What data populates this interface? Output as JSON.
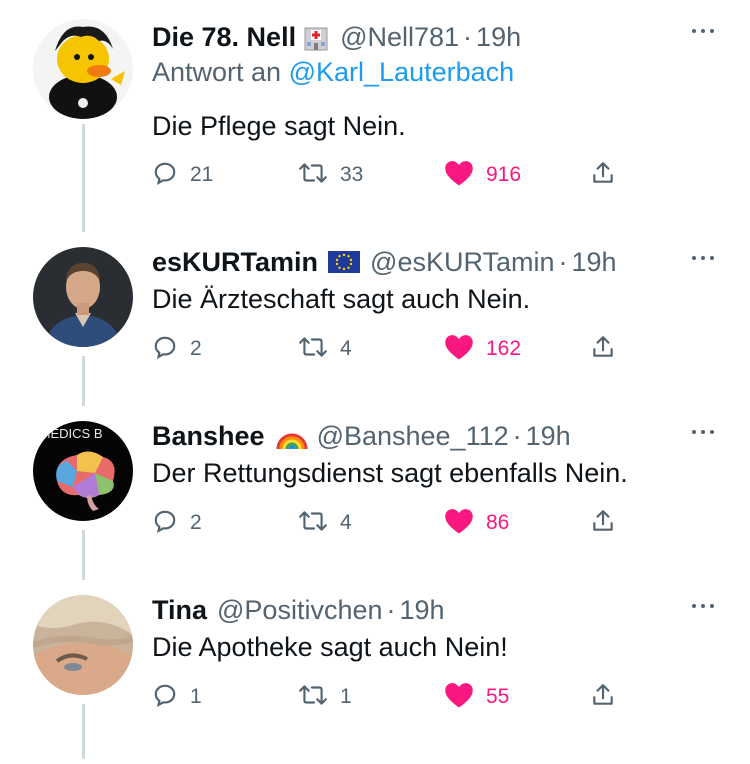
{
  "colors": {
    "accent": "#1d9bf0",
    "like": "#f91880",
    "muted": "#536471",
    "text": "#0f1419"
  },
  "tweets": [
    {
      "name": "Die 78. Nell",
      "badge_icon": "hospital-icon",
      "handle": "@Nell781",
      "separator": "·",
      "time": "19h",
      "reply_prefix": "Antwort an",
      "reply_handle": "@Karl_Lauterbach",
      "text": "Die Pflege sagt Nein.",
      "replies": "21",
      "retweets": "33",
      "likes": "916",
      "liked": true
    },
    {
      "name": "esKURTamin",
      "badge_icon": "eu-flag-icon",
      "handle": "@esKURTamin",
      "separator": "·",
      "time": "19h",
      "text": "Die Ärzteschaft sagt auch Nein.",
      "replies": "2",
      "retweets": "4",
      "likes": "162",
      "liked": true
    },
    {
      "name": "Banshee",
      "badge_icon": "rainbow-icon",
      "handle": "@Banshee_112",
      "separator": "·",
      "time": "19h",
      "avatar_text": "AMEDICS B",
      "text": "Der Rettungsdienst sagt ebenfalls Nein.",
      "replies": "2",
      "retweets": "4",
      "likes": "86",
      "liked": true
    },
    {
      "name": "Tina",
      "handle": "@Positivchen",
      "separator": "·",
      "time": "19h",
      "text": "Die Apotheke sagt auch Nein!",
      "replies": "1",
      "retweets": "1",
      "likes": "55",
      "liked": true
    }
  ]
}
